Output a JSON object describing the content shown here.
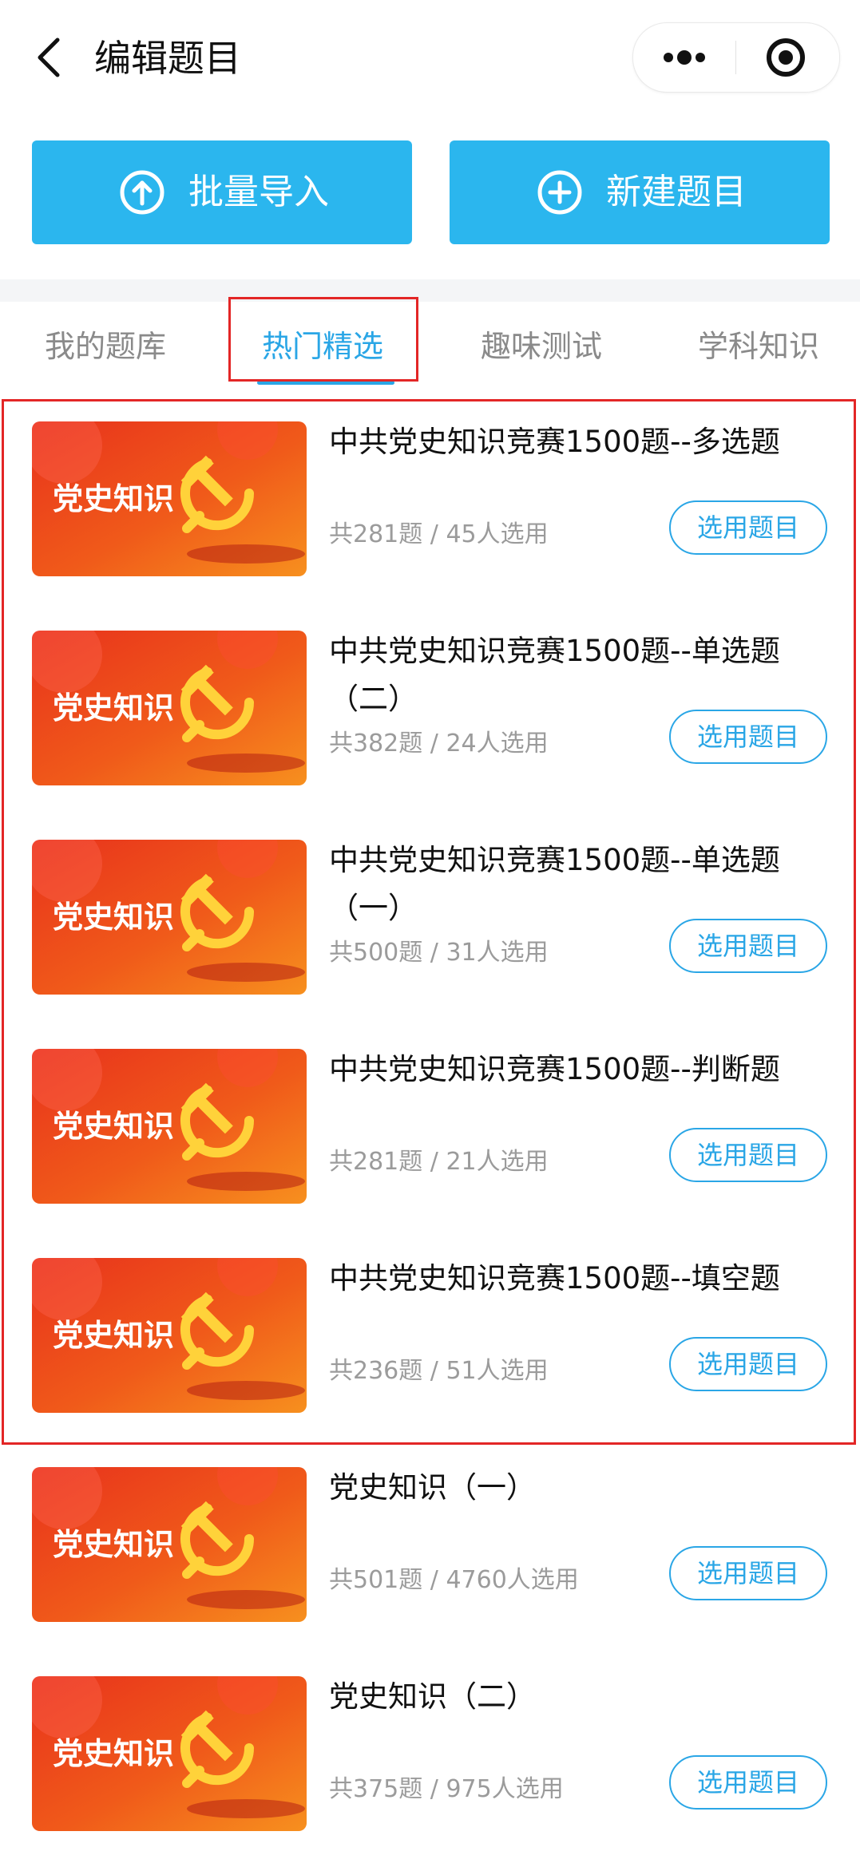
{
  "header": {
    "back_icon": "chevron-left-icon",
    "title": "编辑题目",
    "more_icon": "more-dots-icon",
    "target_icon": "target-icon"
  },
  "actions": {
    "import_label": "批量导入",
    "import_icon": "upload-circle-icon",
    "new_label": "新建题目",
    "new_icon": "plus-circle-icon",
    "accent_color": "#2bb6ee"
  },
  "tabs": [
    {
      "label": "我的题库"
    },
    {
      "label": "热门精选",
      "active": true
    },
    {
      "label": "趣味测试"
    },
    {
      "label": "学科知识"
    }
  ],
  "highlight_color": "#e32626",
  "banks": [
    {
      "thumb_label": "党史知识",
      "title": "中共党史知识竞赛1500题--多选题",
      "meta": "共281题 / 45人选用",
      "button": "选用题目"
    },
    {
      "thumb_label": "党史知识",
      "title": "中共党史知识竞赛1500题--单选题（二）",
      "meta": "共382题 / 24人选用",
      "button": "选用题目"
    },
    {
      "thumb_label": "党史知识",
      "title": "中共党史知识竞赛1500题--单选题（一）",
      "meta": "共500题 / 31人选用",
      "button": "选用题目"
    },
    {
      "thumb_label": "党史知识",
      "title": "中共党史知识竞赛1500题--判断题",
      "meta": "共281题 / 21人选用",
      "button": "选用题目"
    },
    {
      "thumb_label": "党史知识",
      "title": "中共党史知识竞赛1500题--填空题",
      "meta": "共236题 / 51人选用",
      "button": "选用题目"
    },
    {
      "thumb_label": "党史知识",
      "title": "党史知识（一）",
      "meta": "共501题 / 4760人选用",
      "button": "选用题目"
    },
    {
      "thumb_label": "党史知识",
      "title": "党史知识（二）",
      "meta": "共375题 / 975人选用",
      "button": "选用题目"
    }
  ]
}
